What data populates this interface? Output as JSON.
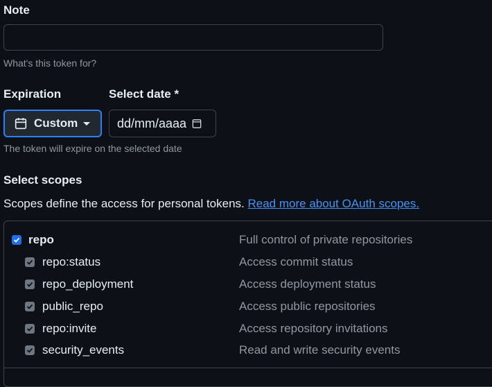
{
  "note": {
    "label": "Note",
    "value": "",
    "help": "What's this token for?"
  },
  "expiration": {
    "label": "Expiration",
    "selected": "Custom",
    "help": "The token will expire on the selected date"
  },
  "date": {
    "label": "Select date *",
    "placeholder": "dd/mm/aaaa"
  },
  "scopes": {
    "label": "Select scopes",
    "description": "Scopes define the access for personal tokens.",
    "link_text": "Read more about OAuth scopes.",
    "items": [
      {
        "name": "repo",
        "description": "Full control of private repositories",
        "checked": true
      },
      {
        "name": "repo:status",
        "description": "Access commit status",
        "checked": true
      },
      {
        "name": "repo_deployment",
        "description": "Access deployment status",
        "checked": true
      },
      {
        "name": "public_repo",
        "description": "Access public repositories",
        "checked": true
      },
      {
        "name": "repo:invite",
        "description": "Access repository invitations",
        "checked": true
      },
      {
        "name": "security_events",
        "description": "Read and write security events",
        "checked": true
      }
    ]
  },
  "colors": {
    "background": "#0d1117",
    "accent": "#1f6feb",
    "link": "#4493f8",
    "muted": "#9198a1"
  },
  "icons": {
    "expiration_button": "calendar-icon",
    "expiration_dropdown": "caret-down-icon",
    "date_picker": "calendar-icon"
  }
}
